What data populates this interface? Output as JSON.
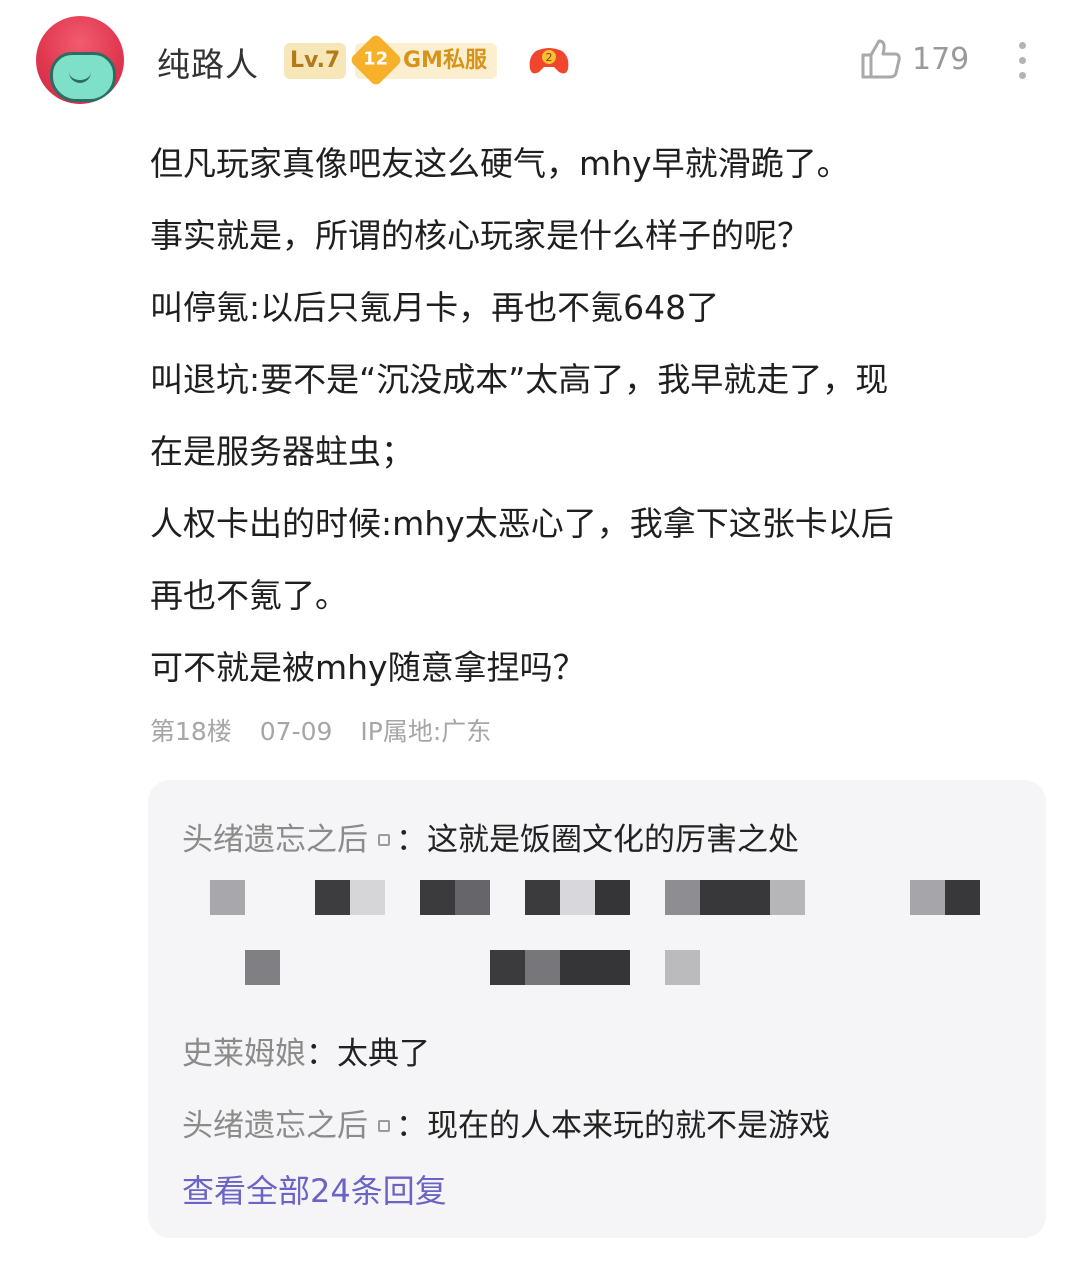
{
  "post": {
    "username": "纯路人",
    "level_badge": "Lv.7",
    "gm_badge": {
      "number": "12",
      "label": "GM私服"
    },
    "likes": "179",
    "body_lines": [
      "但凡玩家真像吧友这么硬气，mhy早就滑跪了。",
      "事实就是，所谓的核心玩家是什么样子的呢？",
      "叫停氪:以后只氪月卡，再也不氪648了",
      "叫退坑:要不是“沉没成本”太高了，我早就走了，现",
      "在是服务器蛀虫；",
      "人权卡出的时候:mhy太恶心了，我拿下这张卡以后",
      "再也不氪了。",
      "可不就是被mhy随意拿捏吗？"
    ],
    "meta": {
      "floor": "第18楼",
      "date": "07-09",
      "ip": "IP属地:广东"
    }
  },
  "replies": [
    {
      "author": "头绪遗忘之后",
      "separator": "：",
      "text": "这就是饭圈文化的厉害之处"
    },
    {
      "author": "史莱姆娘",
      "separator": "：",
      "text": "太典了"
    },
    {
      "author": "头绪遗忘之后",
      "separator": "：",
      "text": "现在的人本来玩的就不是游戏"
    }
  ],
  "view_all": "查看全部24条回复",
  "colors": {
    "link": "#6b63c6",
    "reply_bg": "#f5f5f7",
    "muted": "#a6a6a6"
  }
}
